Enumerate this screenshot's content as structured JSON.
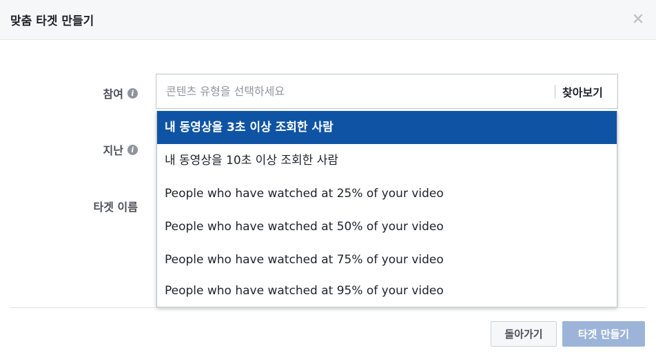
{
  "dialog": {
    "title": "맞춤 타겟 만들기",
    "close_icon": "close-icon"
  },
  "form": {
    "engagement_label": "참여",
    "past_label": "지난",
    "audience_name_label": "타겟 이름",
    "info_icon": "info-icon",
    "search": {
      "placeholder": "콘텐츠 유형을 선택하세요",
      "value": "",
      "browse_label": "찾아보기"
    }
  },
  "dropdown": {
    "options": [
      "내 동영상을 3초 이상 조회한 사람",
      "내 동영상을 10초 이상 조회한 사람",
      "People who have watched at 25% of your video",
      "People who have watched at 50% of your video",
      "People who have watched at 75% of your video",
      "People who have watched at 95% of your video"
    ],
    "selected_index": 0
  },
  "footer": {
    "back_label": "돌아가기",
    "create_label": "타겟 만들기"
  },
  "colors": {
    "selected_option_bg": "#0f54a4",
    "create_button_bg": "#9cb4d8",
    "header_bg": "#f6f7f9"
  }
}
